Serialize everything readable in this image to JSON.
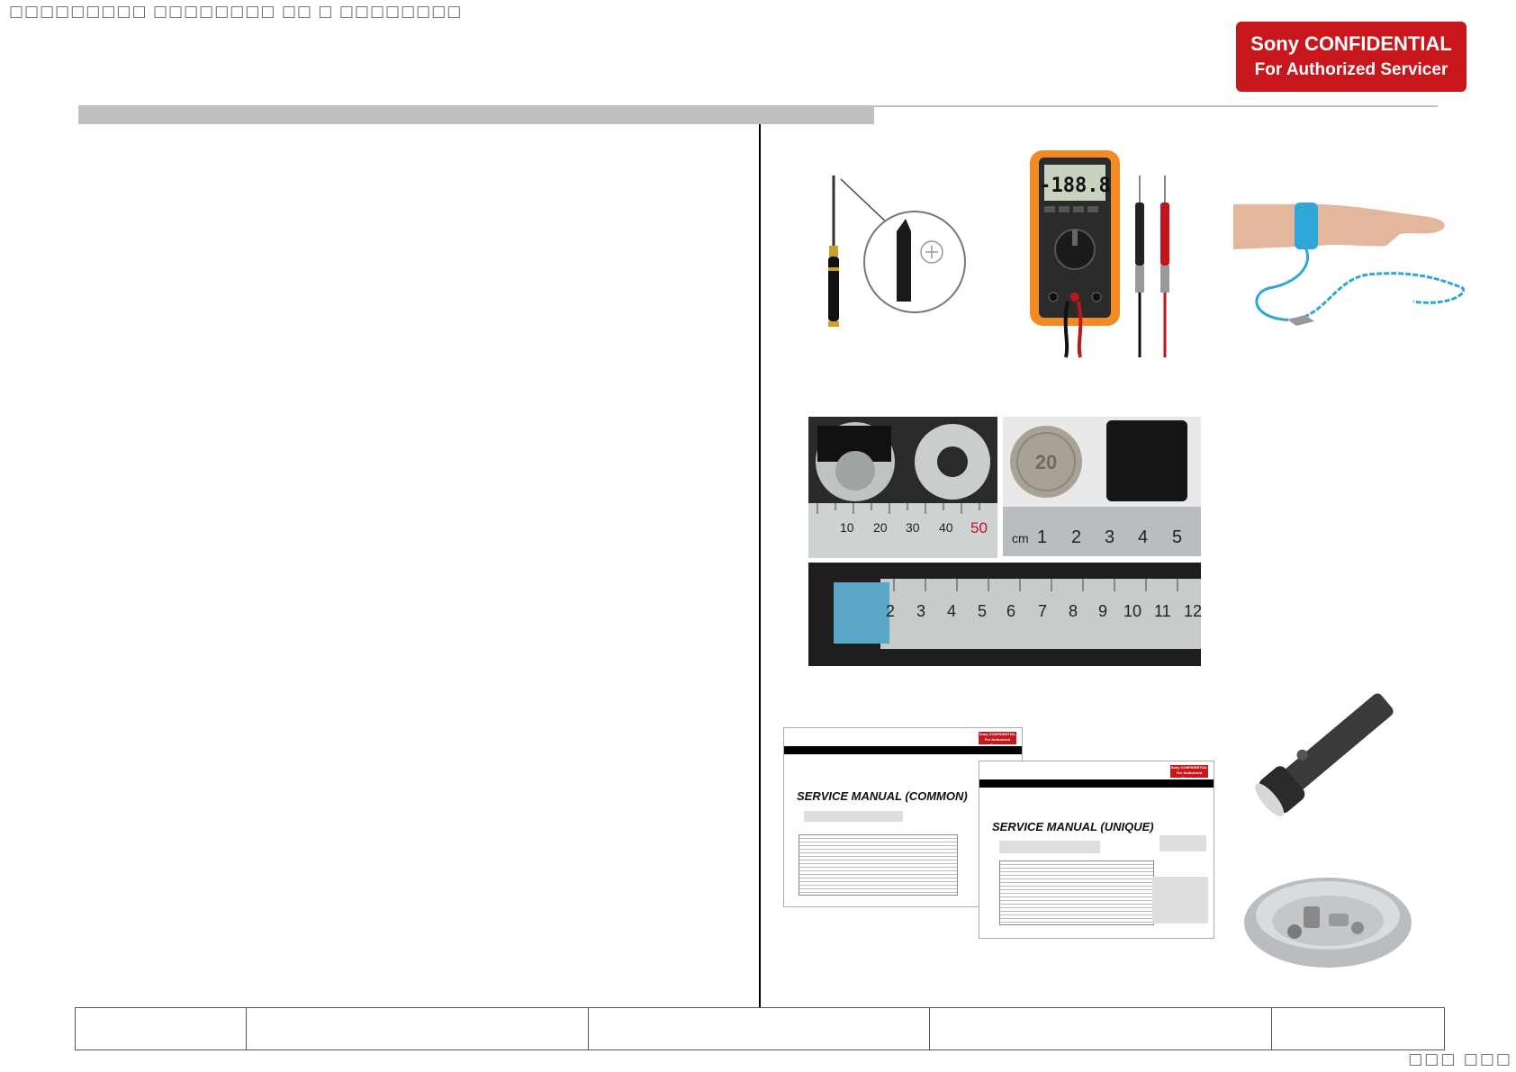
{
  "header": {
    "title_text": "□□□□□□□□□ □□□□□□□□ □□ □ □□□□□□□□"
  },
  "confidential_badge": {
    "line1": "Sony CONFIDENTIAL",
    "line2": "For Authorized Servicer",
    "color": "#c8161d"
  },
  "multimeter_display": "-188.8",
  "ruler_labels_top_left": [
    "10",
    "20",
    "30",
    "40",
    "50"
  ],
  "ruler_labels_top_right": [
    "cm",
    "1",
    "2",
    "3",
    "4",
    "5"
  ],
  "ruler_labels_long": [
    "2",
    "3",
    "4",
    "5",
    "6",
    "7",
    "8",
    "9",
    "10",
    "11",
    "12"
  ],
  "coin_text": "20",
  "manual_common": {
    "title": "SERVICE MANUAL (COMMON)",
    "badge_line1": "Sony CONFIDENTIAL",
    "badge_line2": "For Authorized Servicer"
  },
  "manual_unique": {
    "title": "SERVICE MANUAL (UNIQUE)",
    "badge_line1": "Sony CONFIDENTIAL",
    "badge_line2": "For Authorized Servicer"
  },
  "footer": {
    "cells": [
      "",
      "",
      "",
      "",
      ""
    ]
  },
  "page_number": "□□□ □□□"
}
